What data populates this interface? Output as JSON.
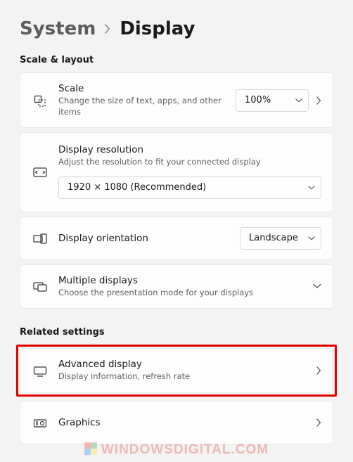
{
  "breadcrumb": {
    "parent": "System",
    "current": "Display"
  },
  "sections": {
    "scale_layout_heading": "Scale & layout",
    "related_heading": "Related settings"
  },
  "scale": {
    "title": "Scale",
    "sub": "Change the size of text, apps, and other items",
    "value": "100%"
  },
  "resolution": {
    "title": "Display resolution",
    "sub": "Adjust the resolution to fit your connected display",
    "value": "1920 × 1080 (Recommended)"
  },
  "orientation": {
    "title": "Display orientation",
    "value": "Landscape"
  },
  "multiple": {
    "title": "Multiple displays",
    "sub": "Choose the presentation mode for your displays"
  },
  "advanced": {
    "title": "Advanced display",
    "sub": "Display information, refresh rate"
  },
  "graphics": {
    "title": "Graphics"
  },
  "watermark": "WINDOWSDIGITAL.COM"
}
